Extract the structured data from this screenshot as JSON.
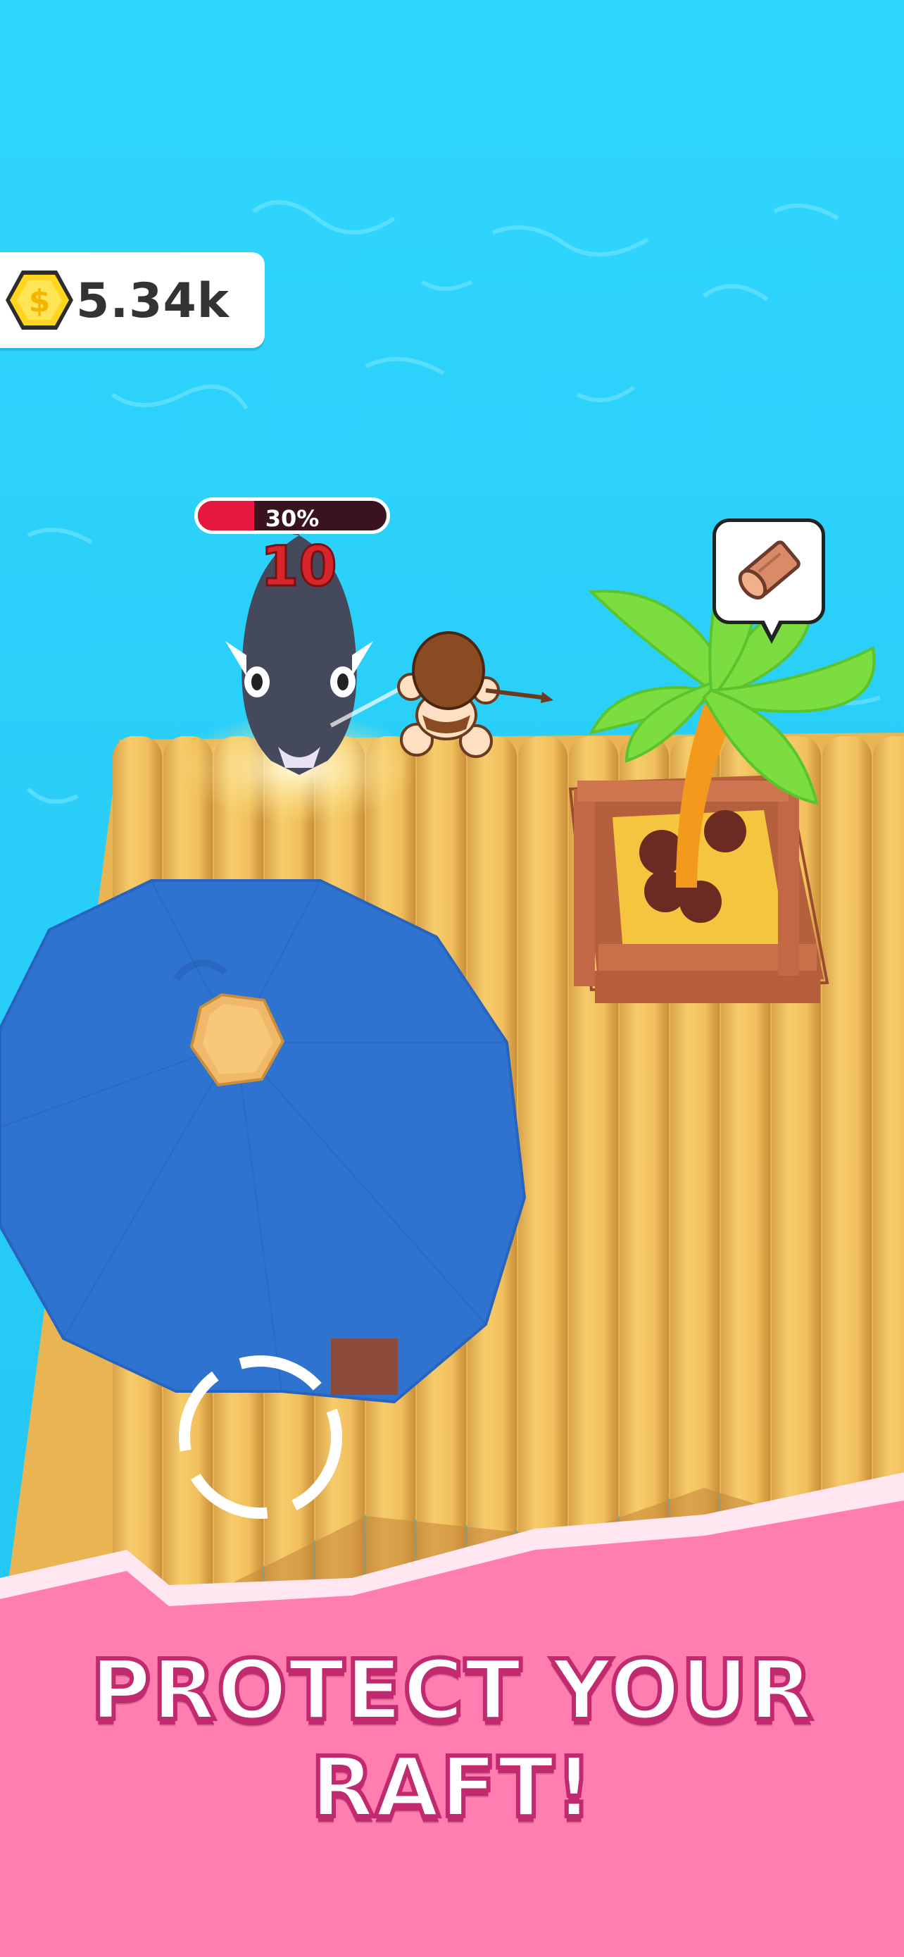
{
  "hud": {
    "coins": "5.34k",
    "coin_icon": "dollar-coin-icon"
  },
  "enemy": {
    "health_percent": 30,
    "health_label": "30%",
    "damage_text": "10"
  },
  "palm_tree": {
    "resource_icon": "wood-log-icon"
  },
  "banner": {
    "text": "PROTECT YOUR RAFT!"
  },
  "colors": {
    "water": "#2fd3fb",
    "raft": "#f2c25e",
    "banner": "#ff7daf",
    "umbrella": "#2f73d1",
    "coin": "#ffd51e",
    "health": "#e8173f"
  }
}
